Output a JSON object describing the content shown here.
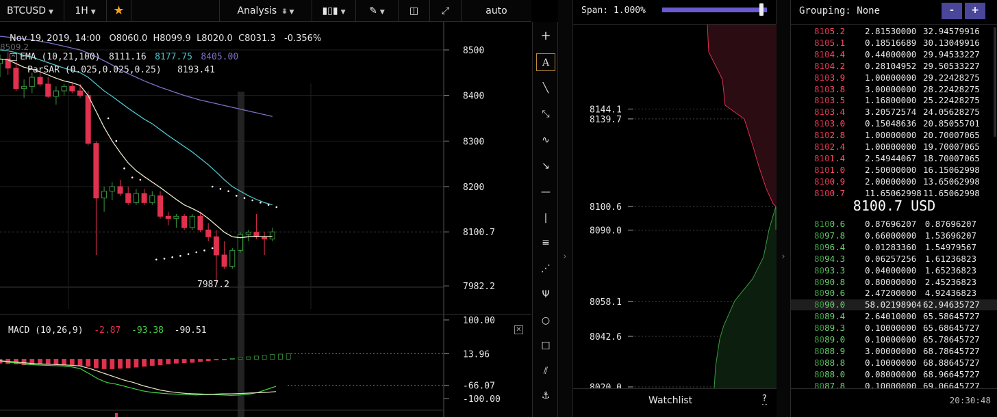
{
  "toolbar": {
    "symbol": "BTCUSD",
    "interval": "1H",
    "analysis_label": "Analysis",
    "scale_mode": "auto"
  },
  "legend": {
    "date": "Nov 19, 2019, 14:00",
    "open": "O8060.0",
    "high": "H8099.9",
    "low": "L8020.0",
    "close": "C8031.3",
    "change": "-0.356%",
    "clipped_label": "8509.2",
    "ema_label": "EMA (10,21,100)",
    "ema1": "8111.16",
    "ema2": "8177.75",
    "ema3": "8405.00",
    "parsar_label": "ParSAR (0.025,0.025,0.25)",
    "parsar_value": "8193.41",
    "macd_label": "MACD (10,26,9)",
    "macd1": "-2.87",
    "macd2": "-93.38",
    "macd3": "-90.51"
  },
  "colors": {
    "up": "#3a9a3f",
    "down": "#e0314f",
    "ema_fast": "#e9e6c6",
    "ema_mid": "#4fc3c9",
    "ema_slow": "#7b72c9",
    "accent": "#4a4699"
  },
  "chart_data": [
    {
      "type": "candlestick",
      "title": "BTCUSD",
      "ylim": [
        7982.2,
        8530
      ],
      "y_ticks": [
        8500,
        8400,
        8300,
        8200,
        8100.7,
        7982.2
      ],
      "y_tick_labels": [
        "8500",
        "8400",
        "8300",
        "8200",
        "8100.7",
        "7982.2"
      ],
      "annotations": [
        "7987.2"
      ],
      "candles": [
        {
          "o": 8470,
          "h": 8490,
          "l": 8440,
          "c": 8480
        },
        {
          "o": 8480,
          "h": 8495,
          "l": 8445,
          "c": 8460
        },
        {
          "o": 8460,
          "h": 8475,
          "l": 8410,
          "c": 8415
        },
        {
          "o": 8415,
          "h": 8435,
          "l": 8395,
          "c": 8420
        },
        {
          "o": 8420,
          "h": 8450,
          "l": 8405,
          "c": 8440
        },
        {
          "o": 8440,
          "h": 8460,
          "l": 8420,
          "c": 8425
        },
        {
          "o": 8425,
          "h": 8440,
          "l": 8395,
          "c": 8398
        },
        {
          "o": 8398,
          "h": 8420,
          "l": 8380,
          "c": 8410
        },
        {
          "o": 8410,
          "h": 8425,
          "l": 8400,
          "c": 8420
        },
        {
          "o": 8420,
          "h": 8430,
          "l": 8405,
          "c": 8410
        },
        {
          "o": 8410,
          "h": 8425,
          "l": 8395,
          "c": 8400
        },
        {
          "o": 8400,
          "h": 8410,
          "l": 8290,
          "c": 8295
        },
        {
          "o": 8295,
          "h": 8300,
          "l": 8050,
          "c": 8175
        },
        {
          "o": 8175,
          "h": 8200,
          "l": 8145,
          "c": 8190
        },
        {
          "o": 8190,
          "h": 8210,
          "l": 8170,
          "c": 8200
        },
        {
          "o": 8200,
          "h": 8215,
          "l": 8180,
          "c": 8185
        },
        {
          "o": 8185,
          "h": 8200,
          "l": 8160,
          "c": 8165
        },
        {
          "o": 8165,
          "h": 8195,
          "l": 8160,
          "c": 8185
        },
        {
          "o": 8185,
          "h": 8195,
          "l": 8160,
          "c": 8165
        },
        {
          "o": 8165,
          "h": 8190,
          "l": 8160,
          "c": 8180
        },
        {
          "o": 8180,
          "h": 8190,
          "l": 8130,
          "c": 8135
        },
        {
          "o": 8135,
          "h": 8145,
          "l": 8115,
          "c": 8130
        },
        {
          "o": 8130,
          "h": 8140,
          "l": 8110,
          "c": 8135
        },
        {
          "o": 8135,
          "h": 8140,
          "l": 8105,
          "c": 8110
        },
        {
          "o": 8110,
          "h": 8140,
          "l": 8105,
          "c": 8135
        },
        {
          "o": 8135,
          "h": 8145,
          "l": 8100,
          "c": 8105
        },
        {
          "o": 8105,
          "h": 8120,
          "l": 8080,
          "c": 8090
        },
        {
          "o": 8090,
          "h": 8105,
          "l": 7987.2,
          "c": 8050
        },
        {
          "o": 8050,
          "h": 8080,
          "l": 8020,
          "c": 8025
        },
        {
          "o": 8025,
          "h": 8065,
          "l": 8020,
          "c": 8060
        },
        {
          "o": 8060,
          "h": 8100,
          "l": 8055,
          "c": 8095
        },
        {
          "o": 8095,
          "h": 8105,
          "l": 8080,
          "c": 8100
        },
        {
          "o": 8100,
          "h": 8140,
          "l": 8085,
          "c": 8090
        },
        {
          "o": 8090,
          "h": 8100,
          "l": 8050,
          "c": 8085
        },
        {
          "o": 8085,
          "h": 8110,
          "l": 8080,
          "c": 8100.7
        }
      ],
      "ema_fast": [
        8480,
        8478,
        8470,
        8462,
        8458,
        8452,
        8445,
        8438,
        8432,
        8428,
        8422,
        8400,
        8365,
        8330,
        8300,
        8275,
        8252,
        8235,
        8222,
        8210,
        8198,
        8185,
        8172,
        8160,
        8152,
        8143,
        8130,
        8115,
        8100,
        8090,
        8088,
        8090,
        8091,
        8090,
        8091
      ],
      "ema_mid": [
        8500,
        8498,
        8494,
        8488,
        8484,
        8478,
        8472,
        8466,
        8460,
        8455,
        8450,
        8440,
        8425,
        8410,
        8398,
        8385,
        8372,
        8360,
        8348,
        8338,
        8325,
        8312,
        8300,
        8288,
        8276,
        8262,
        8248,
        8232,
        8215,
        8200,
        8190,
        8180,
        8172,
        8165,
        8160
      ],
      "ema_slow": [
        8530,
        8528,
        8526,
        8524,
        8522,
        8519,
        8516,
        8512,
        8508,
        8504,
        8500,
        8493,
        8485,
        8476,
        8467,
        8457,
        8448,
        8440,
        8432,
        8425,
        8418,
        8412,
        8406,
        8400,
        8395,
        8390,
        8386,
        8382,
        8378,
        8374,
        8370,
        8366,
        8362,
        8358,
        8354
      ],
      "parsar": [
        null,
        null,
        null,
        null,
        null,
        null,
        null,
        null,
        null,
        null,
        null,
        null,
        null,
        8350,
        8300,
        8240,
        8220,
        8215,
        null,
        null,
        null,
        null,
        null,
        null,
        null,
        null,
        8200,
        8195,
        8190,
        8180,
        8175,
        8170,
        8165,
        8160,
        8155
      ],
      "parsar_lower": [
        null,
        null,
        null,
        null,
        null,
        null,
        null,
        null,
        null,
        null,
        null,
        null,
        null,
        null,
        null,
        null,
        null,
        null,
        null,
        8040,
        8042,
        8045,
        8048,
        8052,
        8056,
        8060,
        8065,
        null,
        null,
        null,
        null,
        null,
        null,
        null,
        null
      ]
    },
    {
      "type": "bar",
      "title": "MACD (10,26,9)",
      "ylim": [
        -110,
        110
      ],
      "y_tick_labels": [
        "100.00",
        "13.96",
        "-66.07",
        "-100.00"
      ],
      "y_ticks": [
        100,
        13.96,
        -66.07,
        -100
      ],
      "histogram": [
        -10,
        -11,
        -12,
        -14,
        -13,
        -12,
        -12,
        -13,
        -14,
        -15,
        -16,
        -18,
        -22,
        -24,
        -24,
        -23,
        -22,
        -20,
        -18,
        -16,
        -14,
        -12,
        -10,
        -9,
        -8,
        -6,
        -4,
        -2,
        0,
        2,
        4,
        6,
        8,
        10,
        12,
        13,
        14
      ],
      "macd_line": [
        -5,
        -8,
        -10,
        -14,
        -15,
        -16,
        -17,
        -18,
        -20,
        -25,
        -38,
        -52,
        -62,
        -66,
        -72,
        -78,
        -84,
        -88,
        -90,
        -92,
        -93,
        -94,
        -95,
        -94,
        -94,
        -95,
        -96,
        -95,
        -93,
        -88,
        -80,
        -72
      ],
      "signal_line": [
        -4,
        -6,
        -8,
        -10,
        -12,
        -13,
        -14,
        -15,
        -16,
        -18,
        -24,
        -32,
        -40,
        -48,
        -56,
        -62,
        -70,
        -76,
        -82,
        -86,
        -89,
        -91,
        -92,
        -93,
        -93,
        -92,
        -92,
        -91,
        -90,
        -89,
        -88,
        -86
      ]
    },
    {
      "type": "area",
      "title": "Depth",
      "y_tick_labels": [
        "8144.1",
        "8139.7",
        "8100.6",
        "8090.0",
        "8058.1",
        "8042.6",
        "8020.0"
      ],
      "y_ticks": [
        8144.1,
        8139.7,
        8100.6,
        8090.0,
        8058.1,
        8042.6,
        8020.0
      ],
      "ylim": [
        8020,
        8180
      ],
      "asks_cum": [
        [
          8180,
          1
        ],
        [
          8172,
          6
        ],
        [
          8165,
          12
        ],
        [
          8158,
          17
        ],
        [
          8150,
          22
        ],
        [
          8144.1,
          23
        ],
        [
          8139.7,
          27
        ],
        [
          8130,
          34
        ],
        [
          8120,
          42
        ],
        [
          8110,
          52
        ],
        [
          8104,
          60
        ],
        [
          8100.7,
          63
        ]
      ],
      "bids_cum": [
        [
          8100.6,
          63
        ],
        [
          8096,
          61
        ],
        [
          8090,
          57
        ],
        [
          8080,
          54
        ],
        [
          8070,
          51
        ],
        [
          8058.1,
          48
        ],
        [
          8050,
          44
        ],
        [
          8042.6,
          40
        ],
        [
          8030,
          33
        ],
        [
          8020,
          28
        ]
      ]
    }
  ],
  "tools": [
    "crosshair",
    "text",
    "trend-line",
    "ray",
    "path",
    "arrow",
    "horizontal-line",
    "vertical-line",
    "parallel-lines",
    "fib-fan",
    "pitchfork",
    "ellipse",
    "rectangle",
    "channel",
    "anchor"
  ],
  "depth": {
    "span_label": "Span: 1.000%",
    "span_fraction": 0.95,
    "watchlist_label": "Watchlist",
    "help_label": "?"
  },
  "book": {
    "grouping_label": "Grouping: None",
    "minus_label": "-",
    "plus_label": "+",
    "mid_label": "8100.7 USD",
    "clock": "20:30:48",
    "asks": [
      {
        "pre": "810",
        "hi": "5.2",
        "size": "2.81530000",
        "total": "32.94579916"
      },
      {
        "pre": "810",
        "hi": "5.1",
        "size": "0.18516689",
        "total": "30.13049916"
      },
      {
        "pre": "810",
        "hi": "4.4",
        "size": "0.44000000",
        "total": "29.94533227"
      },
      {
        "pre": "810",
        "hi": "4.2",
        "size": "0.28104952",
        "total": "29.50533227"
      },
      {
        "pre": "810",
        "hi": "3.9",
        "size": "1.00000000",
        "total": "29.22428275"
      },
      {
        "pre": "810",
        "hi": "3.8",
        "size": "3.00000000",
        "total": "28.22428275"
      },
      {
        "pre": "810",
        "hi": "3.5",
        "size": "1.16800000",
        "total": "25.22428275"
      },
      {
        "pre": "810",
        "hi": "3.4",
        "size": "3.20572574",
        "total": "24.05628275"
      },
      {
        "pre": "810",
        "hi": "3.0",
        "size": "0.15048636",
        "total": "20.85055701"
      },
      {
        "pre": "810",
        "hi": "2.8",
        "size": "1.00000000",
        "total": "20.70007065"
      },
      {
        "pre": "810",
        "hi": "2.4",
        "size": "1.00000000",
        "total": "19.70007065"
      },
      {
        "pre": "810",
        "hi": "1.4",
        "size": "2.54944067",
        "total": "18.70007065"
      },
      {
        "pre": "810",
        "hi": "1.0",
        "size": "2.50000000",
        "total": "16.15062998"
      },
      {
        "pre": "810",
        "hi": "0.9",
        "size": "2.00000000",
        "total": "13.65062998"
      },
      {
        "pre": "810",
        "hi": "0.7",
        "size": "11.65062998",
        "total": "11.65062998"
      }
    ],
    "bids": [
      {
        "pre": "810",
        "hi": "0.6",
        "size": "0.87696207",
        "total": "0.87696207"
      },
      {
        "pre": "80",
        "hi": "97.8",
        "size": "0.66000000",
        "total": "1.53696207"
      },
      {
        "pre": "80",
        "hi": "96.4",
        "size": "0.01283360",
        "total": "1.54979567"
      },
      {
        "pre": "80",
        "hi": "94.3",
        "size": "0.06257256",
        "total": "1.61236823"
      },
      {
        "pre": "80",
        "hi": "93.3",
        "size": "0.04000000",
        "total": "1.65236823"
      },
      {
        "pre": "80",
        "hi": "90.8",
        "size": "0.80000000",
        "total": "2.45236823"
      },
      {
        "pre": "80",
        "hi": "90.6",
        "size": "2.47200000",
        "total": "4.92436823"
      },
      {
        "pre": "80",
        "hi": "90.0",
        "size": "58.02198904",
        "total": "62.94635727"
      },
      {
        "pre": "80",
        "hi": "89.4",
        "size": "2.64010000",
        "total": "65.58645727"
      },
      {
        "pre": "80",
        "hi": "89.3",
        "size": "0.10000000",
        "total": "65.68645727"
      },
      {
        "pre": "80",
        "hi": "89.0",
        "size": "0.10000000",
        "total": "65.78645727"
      },
      {
        "pre": "80",
        "hi": "88.9",
        "size": "3.00000000",
        "total": "68.78645727"
      },
      {
        "pre": "80",
        "hi": "88.8",
        "size": "0.10000000",
        "total": "68.88645727"
      },
      {
        "pre": "80",
        "hi": "88.0",
        "size": "0.08000000",
        "total": "68.96645727"
      },
      {
        "pre": "80",
        "hi": "87.8",
        "size": "0.10000000",
        "total": "69.06645727"
      }
    ],
    "highlight_bid_index": 7
  }
}
